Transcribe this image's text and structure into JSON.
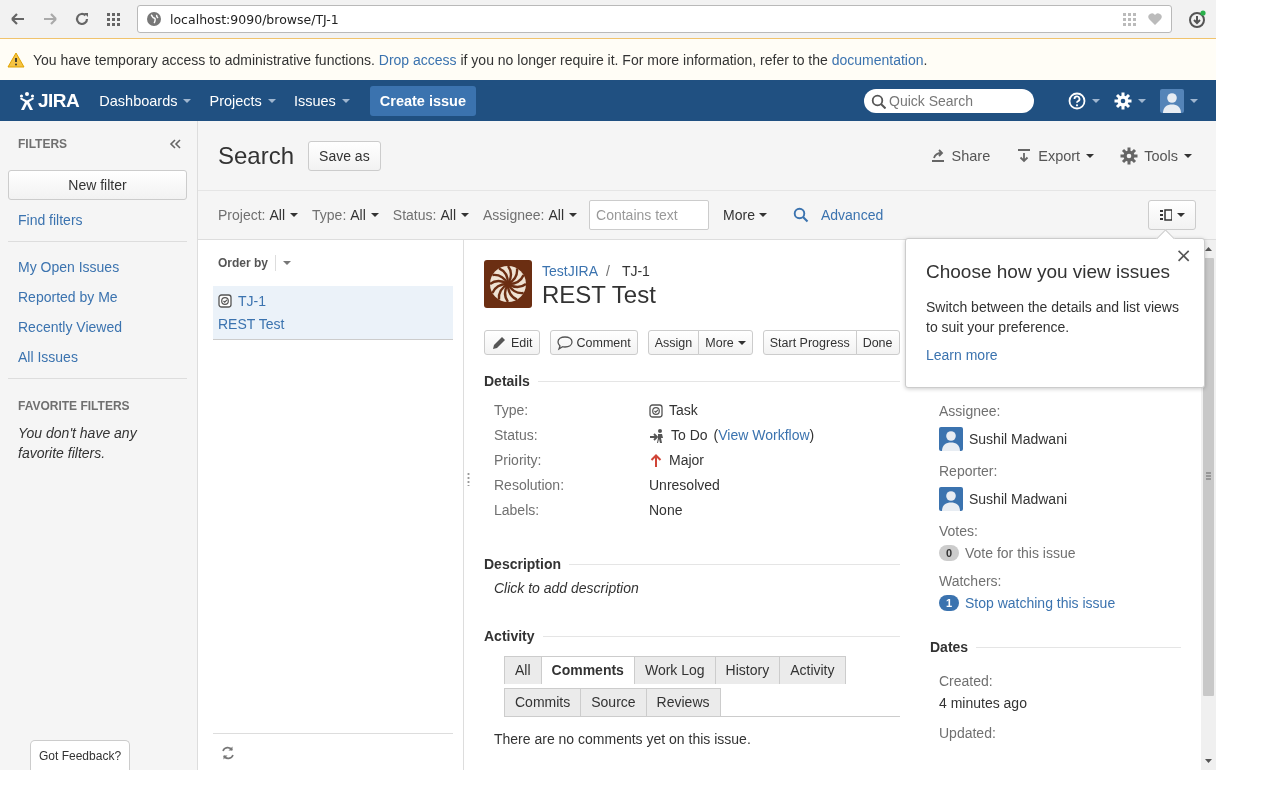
{
  "browser": {
    "url": "localhost:9090/browse/TJ-1"
  },
  "banner": {
    "parts": [
      {
        "kind": "text",
        "text": "You have temporary access to administrative functions."
      },
      {
        "kind": "link",
        "text": "Drop access"
      },
      {
        "kind": "text",
        "text": "if you no longer require it. For more information, refer to the"
      },
      {
        "kind": "link",
        "text": "documentation"
      },
      {
        "kind": "text",
        "text": "."
      }
    ]
  },
  "nav": {
    "logo": "JIRA",
    "items": [
      {
        "label": "Dashboards"
      },
      {
        "label": "Projects"
      },
      {
        "label": "Issues"
      }
    ],
    "create": "Create issue",
    "search": {
      "placeholder": "Quick Search"
    }
  },
  "sidebar": {
    "title": "FILTERS",
    "new_filter": "New filter",
    "find_filters": "Find filters",
    "items": [
      {
        "label": "My Open Issues"
      },
      {
        "label": "Reported by Me"
      },
      {
        "label": "Recently Viewed"
      },
      {
        "label": "All Issues"
      }
    ],
    "favorites_title": "FAVORITE FILTERS",
    "favorites_empty": "You don't have any favorite filters.",
    "feedback": "Got Feedback?"
  },
  "search": {
    "title": "Search",
    "save_as": "Save as",
    "actions": [
      {
        "kind": "share",
        "label": "Share"
      },
      {
        "kind": "export",
        "label": "Export"
      },
      {
        "kind": "tools",
        "label": "Tools"
      }
    ]
  },
  "filters": {
    "items": [
      {
        "label": "Project:",
        "value": "All"
      },
      {
        "label": "Type:",
        "value": "All"
      },
      {
        "label": "Status:",
        "value": "All"
      },
      {
        "label": "Assignee:",
        "value": "All"
      }
    ],
    "text": {
      "placeholder": "Contains text"
    },
    "more": "More",
    "advanced": "Advanced"
  },
  "issue_list": {
    "order_by": "Order by",
    "items": [
      {
        "key": "TJ-1",
        "summary": "REST Test",
        "selected": true
      }
    ]
  },
  "issue": {
    "project": "TestJIRA",
    "separator": "/",
    "key": "TJ-1",
    "title": "REST Test",
    "button_groups": [
      [
        {
          "kind": "edit",
          "label": "Edit"
        }
      ],
      [
        {
          "kind": "comment",
          "label": "Comment"
        }
      ],
      [
        {
          "kind": "plain",
          "label": "Assign"
        },
        {
          "kind": "dropdown",
          "label": "More"
        }
      ],
      [
        {
          "kind": "plain",
          "label": "Start Progress"
        },
        {
          "kind": "plain",
          "label": "Done"
        }
      ]
    ],
    "details_heading": "Details",
    "fields": [
      {
        "kind": "type",
        "label": "Type:",
        "value": "Task"
      },
      {
        "kind": "status",
        "label": "Status:",
        "value": "To Do",
        "link_open": "(",
        "link": "View Workflow",
        "link_close": ")"
      },
      {
        "kind": "priority",
        "label": "Priority:",
        "value": "Major"
      },
      {
        "kind": "plain",
        "label": "Resolution:",
        "value": "Unresolved"
      },
      {
        "kind": "plain",
        "label": "Labels:",
        "value": "None"
      }
    ],
    "description_heading": "Description",
    "description_placeholder": "Click to add description",
    "activity_heading": "Activity",
    "activity_tabs": [
      [
        {
          "label": "All",
          "selected": false
        },
        {
          "label": "Comments",
          "selected": true
        },
        {
          "label": "Work Log",
          "selected": false
        },
        {
          "label": "History",
          "selected": false
        },
        {
          "label": "Activity",
          "selected": false
        }
      ],
      [
        {
          "label": "Commits",
          "selected": false
        },
        {
          "label": "Source",
          "selected": false
        },
        {
          "label": "Reviews",
          "selected": false
        }
      ]
    ],
    "activity_empty": "There are no comments yet on this issue."
  },
  "people": {
    "assignee_label": "Assignee:",
    "assignee": "Sushil Madwani",
    "reporter_label": "Reporter:",
    "reporter": "Sushil Madwani",
    "votes_label": "Votes:",
    "votes_count": "0",
    "vote_link": "Vote for this issue",
    "watchers_label": "Watchers:",
    "watchers_count": "1",
    "watch_link": "Stop watching this issue"
  },
  "dates": {
    "heading": "Dates",
    "created_label": "Created:",
    "created": "4 minutes ago",
    "updated_label": "Updated:"
  },
  "popup": {
    "close": "×",
    "title": "Choose how you view issues",
    "text": "Switch between the details and list views to suit your preference.",
    "link": "Learn more"
  }
}
